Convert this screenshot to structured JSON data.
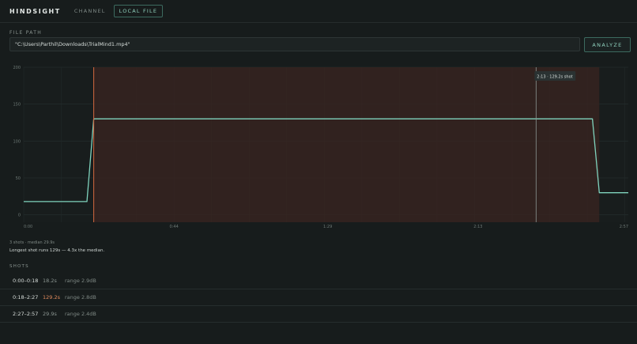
{
  "app": {
    "brand": "HINDSIGHT",
    "tabs": [
      {
        "label": "CHANNEL",
        "active": false
      },
      {
        "label": "LOCAL FILE",
        "active": true
      }
    ]
  },
  "file": {
    "label": "FILE PATH",
    "value": "\"C:\\Users\\Parthil\\Downloads\\TrialMind1.mp4\"",
    "analyze_label": "ANALYZE"
  },
  "chart_data": {
    "type": "line",
    "x_ticks": [
      "0:00",
      "0:44",
      "1:29",
      "2:13",
      "2:57"
    ],
    "y_ticks": [
      "200",
      "150",
      "100",
      "50",
      "0"
    ],
    "xlim_seconds": [
      0,
      177
    ],
    "ylim": [
      -10,
      200
    ],
    "series": [
      {
        "points": [
          [
            0,
            18
          ],
          [
            18.5,
            18
          ],
          [
            20.5,
            130
          ],
          [
            166.5,
            130
          ],
          [
            168.5,
            30
          ],
          [
            177,
            30
          ]
        ]
      }
    ],
    "highlight": {
      "start_seconds": 20.5,
      "end_seconds": 168.5
    },
    "start_marker_seconds": 20.5,
    "cursor": {
      "seconds": 150,
      "label": "2:13 · 129.2s shot"
    },
    "grid": true,
    "colors": {
      "line": "#7fd3bd",
      "highlight": "#3a2420",
      "marker": "#d4683f",
      "cursor": "#8b9592"
    }
  },
  "summary": {
    "stats": "3 shots · median 29.9s",
    "note": "Longest shot runs 129s — 4.3x the median."
  },
  "shots": {
    "label": "SHOTS",
    "items": [
      {
        "range": "0:00–0:18",
        "duration": "18.2s",
        "db": "range 2.9dB",
        "longest": false
      },
      {
        "range": "0:18–2:27",
        "duration": "129.2s",
        "db": "range 2.8dB",
        "longest": true
      },
      {
        "range": "2:27–2:57",
        "duration": "29.9s",
        "db": "range 2.4dB",
        "longest": false
      }
    ]
  }
}
